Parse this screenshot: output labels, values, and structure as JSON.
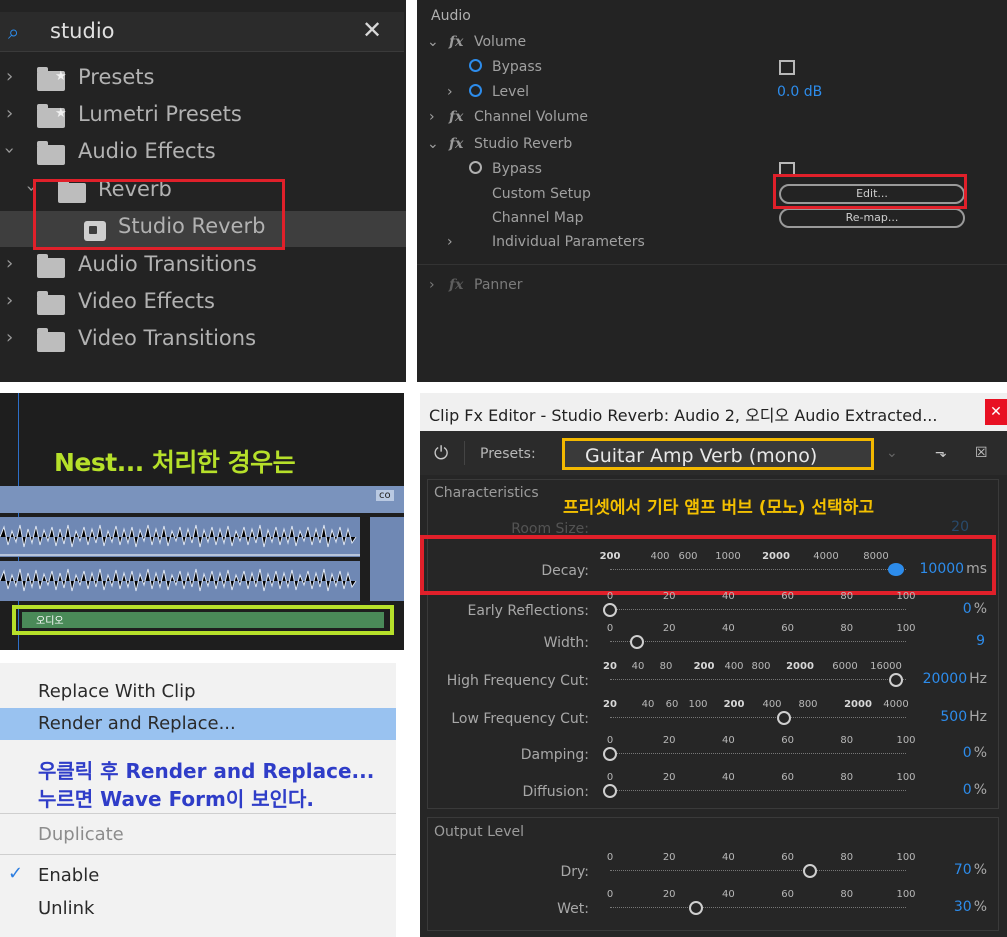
{
  "effects": {
    "search_icon": "search-icon",
    "search_value": "studio",
    "clear_glyph": "✕",
    "items": [
      {
        "label": "Presets"
      },
      {
        "label": "Lumetri Presets"
      },
      {
        "label": "Audio Effects"
      },
      {
        "label": "Reverb"
      },
      {
        "label": "Studio Reverb"
      },
      {
        "label": "Audio Transitions"
      },
      {
        "label": "Video Effects"
      },
      {
        "label": "Video Transitions"
      }
    ]
  },
  "controls": {
    "section": "Audio",
    "volume": "Volume",
    "bypass": "Bypass",
    "level": "Level",
    "level_value": "0.0 dB",
    "channel_volume": "Channel Volume",
    "studio_reverb": "Studio Reverb",
    "custom_setup": "Custom Setup",
    "edit_btn": "Edit...",
    "channel_map": "Channel Map",
    "remap_btn": "Re-map...",
    "individual_params": "Individual Parameters",
    "panner": "Panner"
  },
  "timeline": {
    "caption": "Nest... 처리한 경우는",
    "clip_tag": "co",
    "nest_clip": "오디오"
  },
  "menu": {
    "replace_with_clip": "Replace With Clip",
    "render_and_replace": "Render and Replace...",
    "note_line1": "우클릭 후 Render and Replace...",
    "note_line2": "누르면 Wave Form이 보인다.",
    "duplicate": "Duplicate",
    "enable": "Enable",
    "unlink": "Unlink"
  },
  "editor": {
    "title": "Clip Fx Editor - Studio Reverb: Audio 2, 오디오 Audio Extracted...",
    "close": "✕",
    "presets_label": "Presets:",
    "preset_value": "Guitar Amp Verb (mono)",
    "characteristics": "Characteristics",
    "ko_note": "프리셋에서 기타 앰프 버브 (모노) 선택하고",
    "output_level": "Output Level",
    "params": {
      "room_size": {
        "name": "Room Size:",
        "value": "20",
        "unit": ""
      },
      "decay": {
        "name": "Decay:",
        "value": "10000",
        "unit": "ms"
      },
      "early": {
        "name": "Early Reflections:",
        "value": "0",
        "unit": "%"
      },
      "width": {
        "name": "Width:",
        "value": "9",
        "unit": ""
      },
      "hfc": {
        "name": "High Frequency Cut:",
        "value": "20000",
        "unit": "Hz"
      },
      "lfc": {
        "name": "Low Frequency Cut:",
        "value": "500",
        "unit": "Hz"
      },
      "damping": {
        "name": "Damping:",
        "value": "0",
        "unit": "%"
      },
      "diffusion": {
        "name": "Diffusion:",
        "value": "0",
        "unit": "%"
      },
      "dry": {
        "name": "Dry:",
        "value": "70",
        "unit": "%"
      },
      "wet": {
        "name": "Wet:",
        "value": "30",
        "unit": "%"
      }
    },
    "ticks_linear": [
      "0",
      "20",
      "40",
      "60",
      "80",
      "100"
    ],
    "ticks_decay": [
      "200",
      "400",
      "600",
      "1000",
      "2000",
      "4000",
      "8000"
    ],
    "ticks_hfc": [
      "20",
      "40",
      "80",
      "200",
      "400",
      "800",
      "2000",
      "6000",
      "16000"
    ],
    "ticks_lfc": [
      "20",
      "40",
      "60",
      "100",
      "200",
      "400",
      "800",
      "2000",
      "4000"
    ]
  }
}
